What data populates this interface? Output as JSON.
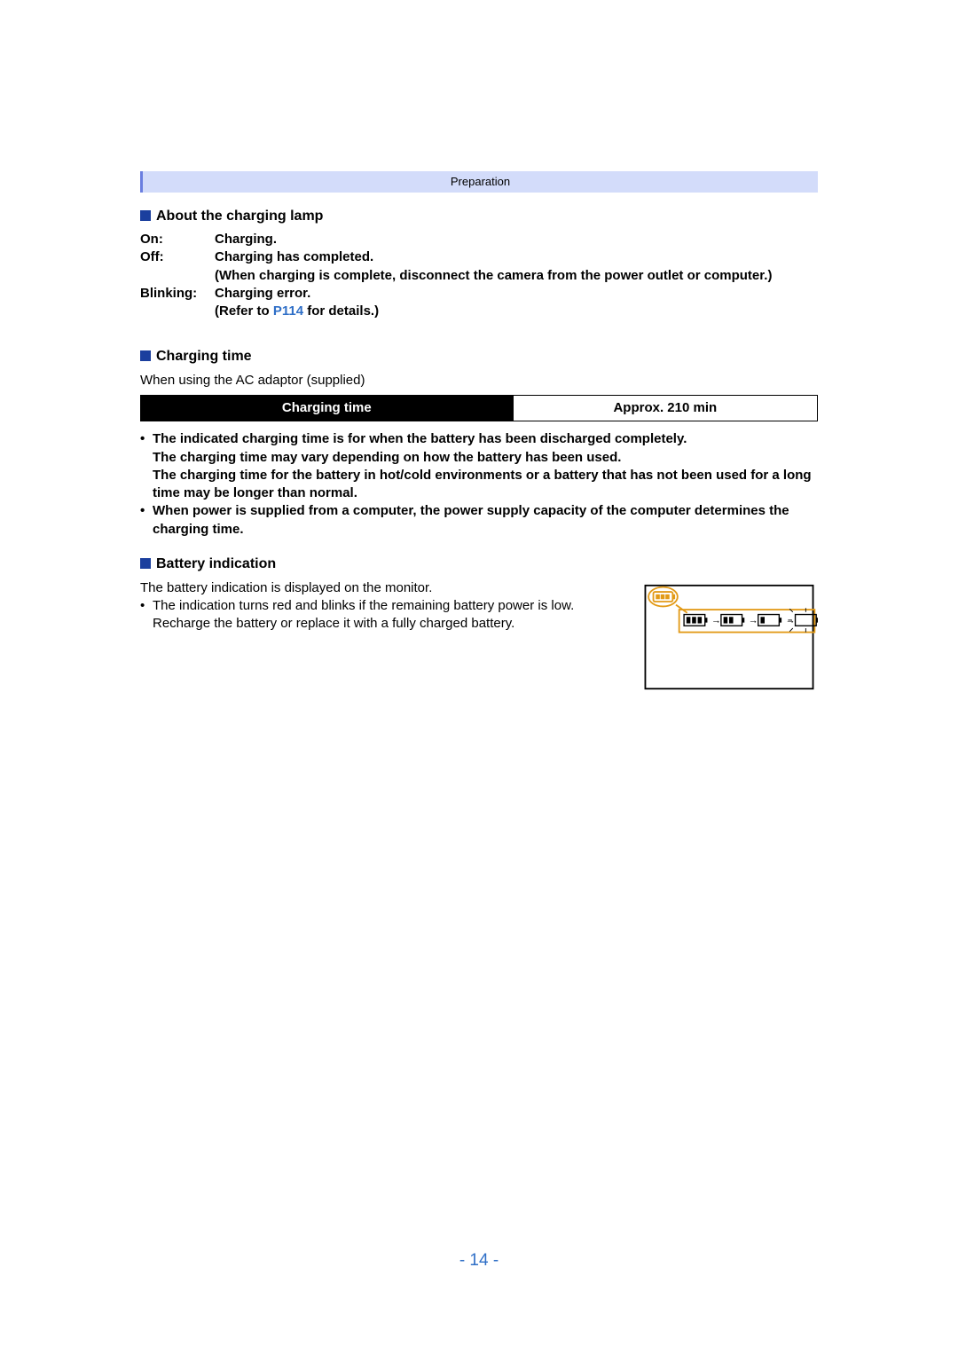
{
  "banner": {
    "label": "Preparation"
  },
  "sec1": {
    "title": "About the charging lamp",
    "rows": {
      "on": {
        "key": "On:",
        "val": "Charging."
      },
      "off": {
        "key": "Off:",
        "val1": "Charging has completed.",
        "val2": "(When charging is complete, disconnect the camera from the power outlet or computer.)"
      },
      "blink": {
        "key": "Blinking:",
        "val1": "Charging error.",
        "val2a": "(Refer to ",
        "link": "P114",
        "val2b": " for details.)"
      }
    }
  },
  "sec2": {
    "title": "Charging time",
    "sub": "When using the AC adaptor (supplied)",
    "table": {
      "label": "Charging time",
      "value": "Approx. 210 min"
    },
    "bullet1a": "The indicated charging time is for when the battery has been discharged completely.",
    "bullet1b": "The charging time may vary depending on how the battery has been used.",
    "bullet1c": "The charging time for the battery in hot/cold environments or a battery that has not been used for a long time may be longer than normal.",
    "bullet2": "When power is supplied from a computer, the power supply capacity of the computer determines the charging time."
  },
  "sec3": {
    "title": "Battery indication",
    "line1": "The battery indication is displayed on the monitor.",
    "line2": "The indication turns red and blinks if the remaining battery power is low. Recharge the battery or replace it with a fully charged battery."
  },
  "page_number": "- 14 -"
}
